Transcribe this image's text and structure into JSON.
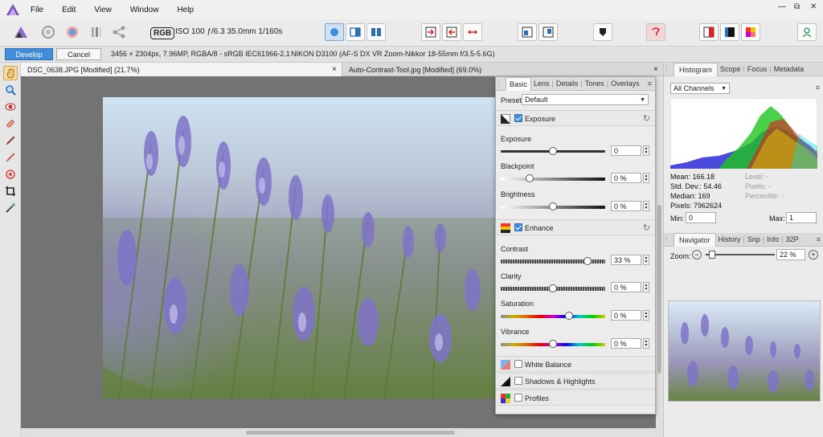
{
  "menu": {
    "items": [
      "File",
      "Edit",
      "View",
      "Window",
      "Help"
    ]
  },
  "window_controls": [
    "—",
    "⧉",
    "✕"
  ],
  "toolbar": {
    "rgb_label": "RGB",
    "exif": "ISO 100 ƒ/6.3 35.0mm 1/160s"
  },
  "persona_bar": {
    "develop_label": "Develop",
    "cancel_label": "Cancel",
    "image_info": "3456 × 2304px, 7.96MP, RGBA/8 - sRGB IEC61966-2.1",
    "camera_info": "NIKON D3100 (AF-S DX VR Zoom-Nikkor 18-55mm f/3.5-5.6G)"
  },
  "doc_tabs": [
    {
      "title": "DSC_0638.JPG [Modified] (21.7%)",
      "close": "×"
    },
    {
      "title": "Auto-Contrast-Tool.jpg [Modified] (69.0%)",
      "close": "×"
    }
  ],
  "adjust_panel": {
    "tabs": [
      "Basic",
      "Lens",
      "Details",
      "Tones",
      "Overlays"
    ],
    "menu": "≡",
    "preset_label": "Preset:",
    "preset_value": "Default",
    "exposure_section": {
      "label": "Exposure",
      "checked": true
    },
    "exposure": {
      "label": "Exposure",
      "value": "0",
      "level": 0.5
    },
    "blackpoint": {
      "label": "Blackpoint",
      "value": "0 %",
      "level": 0.28
    },
    "brightness": {
      "label": "Brightness",
      "value": "0 %",
      "level": 0.5
    },
    "enhance_section": {
      "label": "Enhance",
      "checked": true
    },
    "contrast": {
      "label": "Contrast",
      "value": "33 %",
      "level": 0.83
    },
    "clarity": {
      "label": "Clarity",
      "value": "0 %",
      "level": 0.5
    },
    "saturation": {
      "label": "Saturation",
      "value": "0 %",
      "level": 0.65
    },
    "vibrance": {
      "label": "Vibrance",
      "value": "0 %",
      "level": 0.5
    },
    "white_balance": {
      "label": "White Balance",
      "checked": false
    },
    "shadows_highlights": {
      "label": "Shadows & Highlights",
      "checked": false
    },
    "profiles": {
      "label": "Profiles",
      "checked": false
    }
  },
  "histogram_panel": {
    "tabs": [
      "Histogram",
      "Scope",
      "Focus",
      "Metadata"
    ],
    "channel": "All Channels",
    "mean": "Mean: 166.18",
    "stddev": "Std. Dev.: 54.46",
    "median": "Median: 169",
    "pixels": "Pixels: 7962624",
    "level": "Level: -",
    "pixels_right": "Pixels: -",
    "percentile": "Percentile: -",
    "min_label": "Min:",
    "min_value": "0",
    "max_label": "Max:",
    "max_value": "1"
  },
  "navigator_panel": {
    "tabs": [
      "Navigator",
      "History",
      "Snp",
      "Info",
      "32P"
    ],
    "zoom_label": "Zoom:",
    "zoom_value": "22 %",
    "zoom_minus": "−",
    "zoom_plus": "+"
  },
  "colors": {
    "accent": "#3f8ddb",
    "canvas_bg": "#737373",
    "panel_bg": "#ececec"
  }
}
